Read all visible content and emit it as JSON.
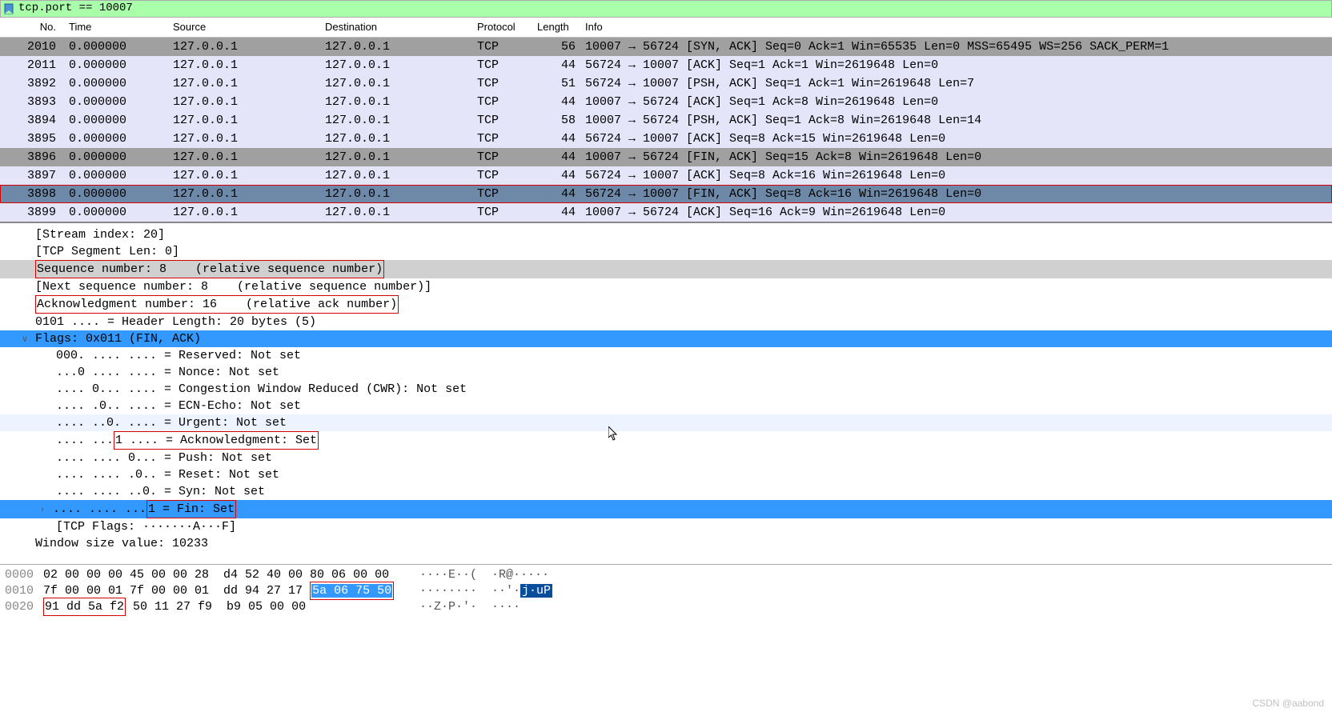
{
  "filter": "tcp.port == 10007",
  "columns": [
    "No.",
    "Time",
    "Source",
    "Destination",
    "Protocol",
    "Length",
    "Info"
  ],
  "packets": [
    {
      "no": "2010",
      "time": "0.000000",
      "src": "127.0.0.1",
      "dst": "127.0.0.1",
      "proto": "TCP",
      "len": "56",
      "info": "10007 → 56724 [SYN, ACK] Seq=0 Ack=1 Win=65535 Len=0 MSS=65495 WS=256 SACK_PERM=1",
      "cls": "gray"
    },
    {
      "no": "2011",
      "time": "0.000000",
      "src": "127.0.0.1",
      "dst": "127.0.0.1",
      "proto": "TCP",
      "len": "44",
      "info": "56724 → 10007 [ACK] Seq=1 Ack=1 Win=2619648 Len=0",
      "cls": "even"
    },
    {
      "no": "3892",
      "time": "0.000000",
      "src": "127.0.0.1",
      "dst": "127.0.0.1",
      "proto": "TCP",
      "len": "51",
      "info": "56724 → 10007 [PSH, ACK] Seq=1 Ack=1 Win=2619648 Len=7",
      "cls": "even"
    },
    {
      "no": "3893",
      "time": "0.000000",
      "src": "127.0.0.1",
      "dst": "127.0.0.1",
      "proto": "TCP",
      "len": "44",
      "info": "10007 → 56724 [ACK] Seq=1 Ack=8 Win=2619648 Len=0",
      "cls": "even"
    },
    {
      "no": "3894",
      "time": "0.000000",
      "src": "127.0.0.1",
      "dst": "127.0.0.1",
      "proto": "TCP",
      "len": "58",
      "info": "10007 → 56724 [PSH, ACK] Seq=1 Ack=8 Win=2619648 Len=14",
      "cls": "even"
    },
    {
      "no": "3895",
      "time": "0.000000",
      "src": "127.0.0.1",
      "dst": "127.0.0.1",
      "proto": "TCP",
      "len": "44",
      "info": "56724 → 10007 [ACK] Seq=8 Ack=15 Win=2619648 Len=0",
      "cls": "even"
    },
    {
      "no": "3896",
      "time": "0.000000",
      "src": "127.0.0.1",
      "dst": "127.0.0.1",
      "proto": "TCP",
      "len": "44",
      "info": "10007 → 56724 [FIN, ACK] Seq=15 Ack=8 Win=2619648 Len=0",
      "cls": "gray"
    },
    {
      "no": "3897",
      "time": "0.000000",
      "src": "127.0.0.1",
      "dst": "127.0.0.1",
      "proto": "TCP",
      "len": "44",
      "info": "56724 → 10007 [ACK] Seq=8 Ack=16 Win=2619648 Len=0",
      "cls": "even"
    },
    {
      "no": "3898",
      "time": "0.000000",
      "src": "127.0.0.1",
      "dst": "127.0.0.1",
      "proto": "TCP",
      "len": "44",
      "info": "56724 → 10007 [FIN, ACK] Seq=8 Ack=16 Win=2619648 Len=0",
      "cls": "sel",
      "outline": true
    },
    {
      "no": "3899",
      "time": "0.000000",
      "src": "127.0.0.1",
      "dst": "127.0.0.1",
      "proto": "TCP",
      "len": "44",
      "info": "10007 → 56724 [ACK] Seq=16 Ack=9 Win=2619648 Len=0",
      "cls": "even"
    }
  ],
  "details": {
    "stream_index": "[Stream index: 20]",
    "seg_len": "[TCP Segment Len: 0]",
    "seq": "Sequence number: 8    (relative sequence number)",
    "next_seq": "[Next sequence number: 8    (relative sequence number)]",
    "ack": "Acknowledgment number: 16    (relative ack number)",
    "hdr_len": "0101 .... = Header Length: 20 bytes (5)",
    "flags_title": "Flags: 0x011 (FIN, ACK)",
    "flag_reserved": "000. .... .... = Reserved: Not set",
    "flag_nonce": "...0 .... .... = Nonce: Not set",
    "flag_cwr": ".... 0... .... = Congestion Window Reduced (CWR): Not set",
    "flag_ecn": ".... .0.. .... = ECN-Echo: Not set",
    "flag_urg": ".... ..0. .... = Urgent: Not set",
    "flag_ack_pre": ".... ...",
    "flag_ack_box": "1 .... = Acknowledgment: Set",
    "flag_push": ".... .... 0... = Push: Not set",
    "flag_reset": ".... .... .0.. = Reset: Not set",
    "flag_syn": ".... .... ..0. = Syn: Not set",
    "flag_fin_pre": ".... .... ..",
    "flag_fin_mid": ".",
    "flag_fin_box": "1 = Fin: Set",
    "tcp_flags": "[TCP Flags: ·······A···F]",
    "win": "Window size value: 10233"
  },
  "hex": [
    {
      "off": "0000",
      "bytes": "02 00 00 00 45 00 00 28  d4 52 40 00 80 06 00 00",
      "ascii": "····E··(  ·R@·····"
    },
    {
      "off": "0010",
      "bytes_pre": "7f 00 00 01 7f 00 00 01  dd 94 27 17 ",
      "bytes_hl": "5a 06 75 50",
      "ascii_pre": "········  ··'·",
      "ascii_hl": "j·uP"
    },
    {
      "off": "0020",
      "bytes_box": "91 dd 5a f2",
      "bytes_rest": " 50 11 27 f9  b9 05 00 00",
      "ascii": "··Z·P·'·  ····"
    }
  ],
  "watermark": "CSDN @aabond"
}
